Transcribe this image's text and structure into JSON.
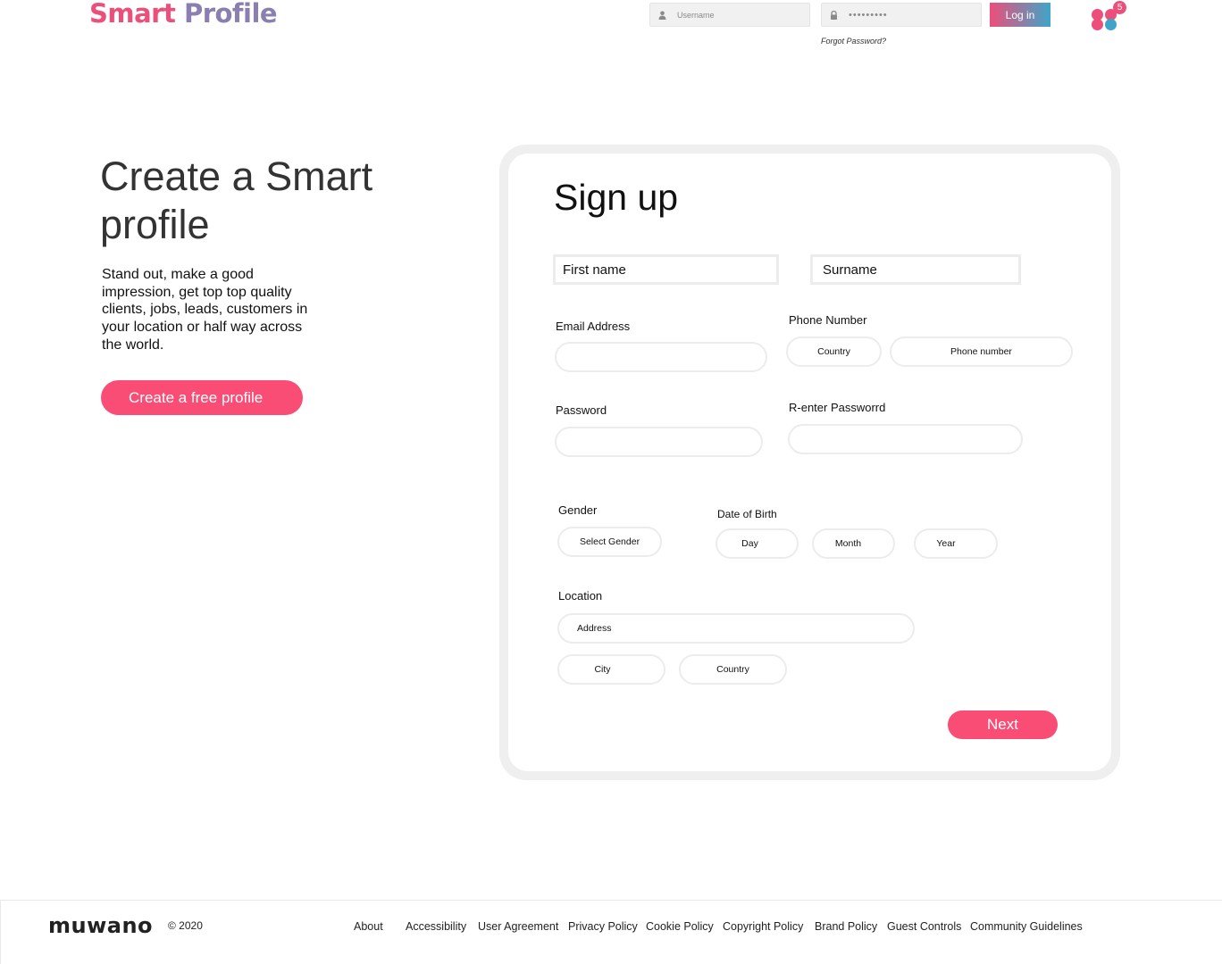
{
  "header": {
    "logo_part1": "Smart",
    "logo_part2": "Profile",
    "username_placeholder": "Username",
    "password_masked": "•••••••••",
    "login_label": "Log in",
    "forgot_password": "Forgot Password?",
    "apps_badge": "5"
  },
  "hero": {
    "title": "Create a Smart profile",
    "description": "Stand out, make a good impression, get top top quality clients, jobs, leads, customers in your location or half way across the world.",
    "cta_label": "Create a free profile"
  },
  "form": {
    "title": "Sign up",
    "first_name_placeholder": "First name",
    "surname_placeholder": "Surname",
    "email_label": "Email Address",
    "phone_label": "Phone Number",
    "phone_country": "Country",
    "phone_number": "Phone number",
    "password_label": "Password",
    "reenter_label": "R-enter Passworrd",
    "gender_label": "Gender",
    "gender_value": "Select Gender",
    "dob_label": "Date of Birth",
    "dob_day": "Day",
    "dob_month": "Month",
    "dob_year": "Year",
    "location_label": "Location",
    "address": "Address",
    "city": "City",
    "country": "Country",
    "next_label": "Next"
  },
  "footer": {
    "brand": "muwano",
    "copyright": "© 2020",
    "links": [
      "About",
      "Accessibility",
      "User Agreement",
      "Privacy Policy",
      "Cookie Policy",
      "Copyright Policy",
      "Brand Policy",
      "Guest Controls",
      "Community Guidelines"
    ]
  },
  "colors": {
    "accent_pink": "#fa4d76",
    "brand_pink": "#ec4f7a",
    "brand_purple": "#8a7fb0",
    "brand_blue": "#3fa5c8"
  },
  "icons": [
    "user-icon",
    "lock-icon",
    "apps-icon"
  ]
}
